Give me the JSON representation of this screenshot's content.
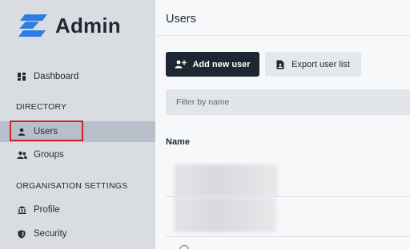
{
  "brand": {
    "name": "Admin"
  },
  "sidebar": {
    "items_top": [
      {
        "label": "Dashboard",
        "icon": "dashboard-icon"
      }
    ],
    "sections": [
      {
        "label": "DIRECTORY",
        "items": [
          {
            "label": "Users",
            "icon": "user-icon",
            "active": true
          },
          {
            "label": "Groups",
            "icon": "users-icon"
          }
        ]
      },
      {
        "label": "ORGANISATION SETTINGS",
        "items": [
          {
            "label": "Profile",
            "icon": "building-icon"
          },
          {
            "label": "Security",
            "icon": "shield-icon"
          }
        ]
      }
    ]
  },
  "main": {
    "title": "Users",
    "actions": {
      "add": "Add new user",
      "export": "Export user list"
    },
    "filter": {
      "placeholder": "Filter by name",
      "value": ""
    },
    "table": {
      "columns": [
        "Name"
      ]
    }
  },
  "colors": {
    "sidebar_bg": "#d9dde2",
    "active_bg": "#b7c0ca",
    "primary": "#1d2733",
    "brand_blue": "#2f7de1",
    "highlight": "#d71f26"
  }
}
